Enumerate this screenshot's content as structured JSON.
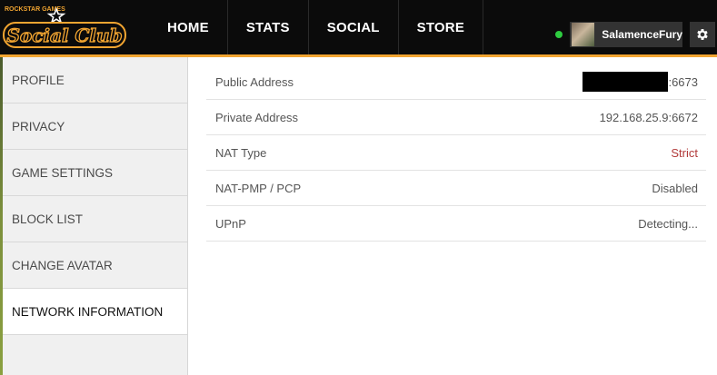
{
  "brand": {
    "logo_small_text": "ROCKSTAR GAMES",
    "logo_text": "Social Club",
    "accent_color": "#f2a531"
  },
  "nav": {
    "items": [
      {
        "label": "HOME"
      },
      {
        "label": "STATS"
      },
      {
        "label": "SOCIAL"
      },
      {
        "label": "STORE"
      }
    ]
  },
  "user": {
    "status": "online",
    "status_color": "#2ecc40",
    "name": "SalamenceFury",
    "settings_icon": "gear-icon"
  },
  "sidebar": {
    "items": [
      {
        "label": "PROFILE",
        "active": false
      },
      {
        "label": "PRIVACY",
        "active": false
      },
      {
        "label": "GAME SETTINGS",
        "active": false
      },
      {
        "label": "BLOCK LIST",
        "active": false
      },
      {
        "label": "CHANGE AVATAR",
        "active": false
      },
      {
        "label": "NETWORK INFORMATION",
        "active": true
      }
    ]
  },
  "network": {
    "rows": [
      {
        "label": "Public Address",
        "value": ":6673",
        "redacted": true
      },
      {
        "label": "Private Address",
        "value": "192.168.25.9:6672"
      },
      {
        "label": "NAT Type",
        "value": "Strict",
        "color": "#b23a3a"
      },
      {
        "label": "NAT-PMP / PCP",
        "value": "Disabled"
      },
      {
        "label": "UPnP",
        "value": "Detecting..."
      }
    ]
  }
}
